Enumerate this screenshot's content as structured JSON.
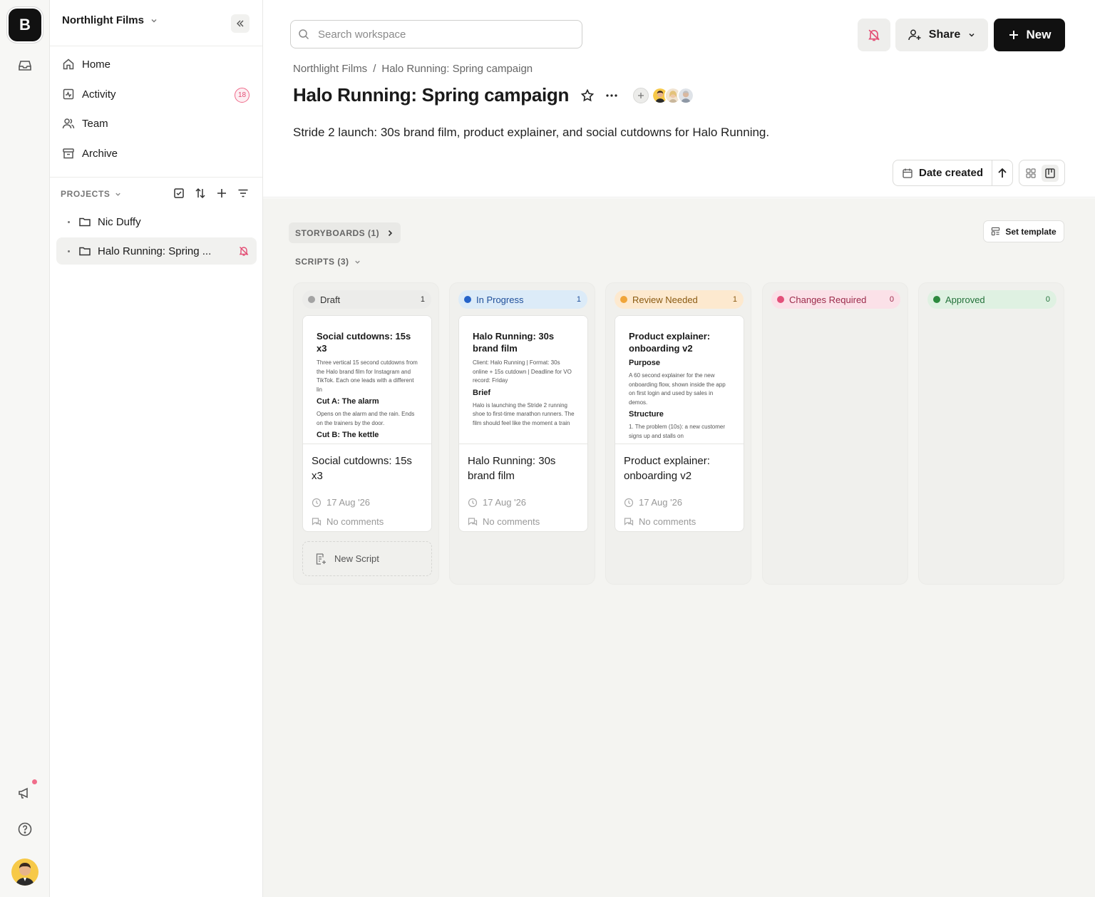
{
  "rail": {
    "logo_letter": "B",
    "icons": [
      "inbox-icon",
      "megaphone-icon",
      "help-icon"
    ]
  },
  "sidebar": {
    "workspace": "Northlight Films",
    "nav": [
      {
        "label": "Home",
        "icon": "home-icon"
      },
      {
        "label": "Activity",
        "icon": "activity-icon",
        "badge": "18"
      },
      {
        "label": "Team",
        "icon": "team-icon"
      },
      {
        "label": "Archive",
        "icon": "archive-icon"
      }
    ],
    "projects_label": "PROJECTS",
    "projects": [
      {
        "name": "Nic Duffy"
      },
      {
        "name": "Halo Running: Spring ..."
      }
    ]
  },
  "header": {
    "search_placeholder": "Search workspace",
    "share_label": "Share",
    "new_label": "New",
    "breadcrumb": [
      "Northlight Films",
      "/",
      "Halo Running: Spring campaign"
    ],
    "title": "Halo Running: Spring campaign",
    "description": "Stride 2 launch: 30s brand film, product explainer, and social cutdowns for Halo Running.",
    "sort_label": "Date created"
  },
  "board": {
    "storyboards_label": "STORYBOARDS (1)",
    "scripts_label": "SCRIPTS (3)",
    "set_template_label": "Set template",
    "new_script_label": "New Script",
    "columns": [
      {
        "name": "Draft",
        "count": "1",
        "color": "#a3a3a3",
        "bg": "#ececea",
        "text": "#333333"
      },
      {
        "name": "In Progress",
        "count": "1",
        "color": "#2563c9",
        "bg": "#dcebf8",
        "text": "#1f4f9a"
      },
      {
        "name": "Review Needed",
        "count": "1",
        "color": "#f0a53a",
        "bg": "#fde9cf",
        "text": "#8a5a12"
      },
      {
        "name": "Changes Required",
        "count": "0",
        "color": "#e3507a",
        "bg": "#fbe1e8",
        "text": "#9b2a4a"
      },
      {
        "name": "Approved",
        "count": "0",
        "color": "#2c8a3e",
        "bg": "#dff1e2",
        "text": "#23713a"
      }
    ],
    "cards": [
      {
        "preview_title": "Social cutdowns: 15s x3",
        "preview_blocks": [
          {
            "type": "p",
            "text": "Three vertical 15 second cutdowns from the Halo brand film for Instagram and TikTok. Each one leads with a different lin"
          },
          {
            "type": "h",
            "text": "Cut A: The alarm"
          },
          {
            "type": "p",
            "text": "Opens on the alarm and the rain. Ends on the trainers by the door."
          },
          {
            "type": "h",
            "text": "Cut B: The kettle"
          }
        ],
        "name": "Social cutdowns: 15s x3",
        "date": "17 Aug '26",
        "comments": "No comments"
      },
      {
        "preview_title": "Halo Running: 30s brand film",
        "preview_blocks": [
          {
            "type": "p",
            "text": "Client: Halo Running | Format: 30s online + 15s cutdown | Deadline for VO record: Friday"
          },
          {
            "type": "h",
            "text": "Brief"
          },
          {
            "type": "p",
            "text": "Halo is launching the Stride 2 running shoe to first-time marathon runners. The film should feel like the moment a train"
          }
        ],
        "name": "Halo Running: 30s brand film",
        "date": "17 Aug '26",
        "comments": "No comments"
      },
      {
        "preview_title": "Product explainer: onboarding v2",
        "preview_blocks": [
          {
            "type": "h",
            "text": "Purpose"
          },
          {
            "type": "p",
            "text": "A 60 second explainer for the new onboarding flow, shown inside the app on first login and used by sales in demos."
          },
          {
            "type": "h",
            "text": "Structure"
          },
          {
            "type": "p",
            "text": "1.  The problem (10s): a new customer signs up and stalls on"
          }
        ],
        "name": "Product explainer: onboarding v2",
        "date": "17 Aug '26",
        "comments": "No comments"
      }
    ]
  }
}
